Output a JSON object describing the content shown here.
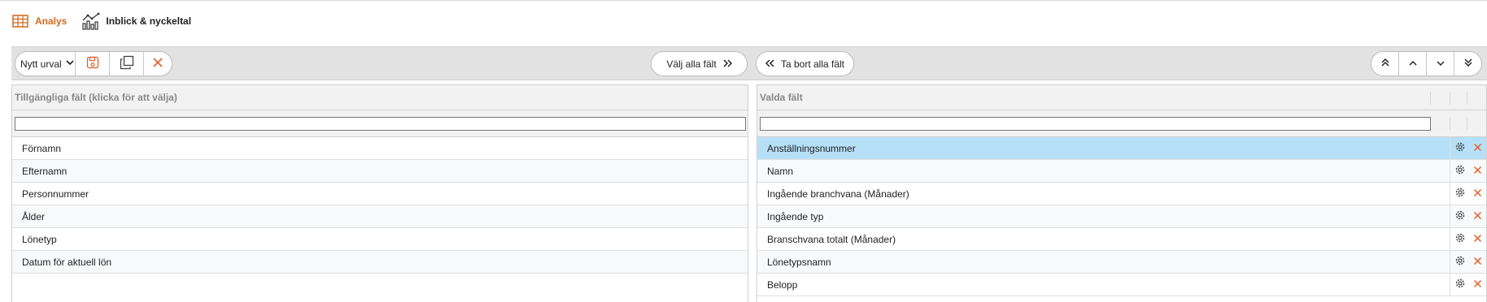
{
  "tabs": [
    {
      "label": "Analys",
      "icon": "table-icon",
      "active": true
    },
    {
      "label": "Inblick & nyckeltal",
      "icon": "chart-icon",
      "active": false
    }
  ],
  "toolbar": {
    "select_value": "Nytt urval",
    "select_all_label": "Välj alla fält",
    "remove_all_label": "Ta bort alla fält"
  },
  "available": {
    "header": "Tillgängliga fält (klicka för att välja)",
    "filter_value": "",
    "items": [
      "Förnamn",
      "Efternamn",
      "Personnummer",
      "Ålder",
      "Lönetyp",
      "Datum för aktuell lön"
    ]
  },
  "selected": {
    "header": "Valda fält",
    "filter_value": "",
    "items": [
      "Anställningsnummer",
      "Namn",
      "Ingående branchvana (Månader)",
      "Ingående typ",
      "Branschvana totalt (Månader)",
      "Lönetypsnamn",
      "Belopp"
    ]
  },
  "colors": {
    "accent": "#d2691e",
    "selected_row": "#b6e0f7",
    "delete": "#e0602a"
  }
}
